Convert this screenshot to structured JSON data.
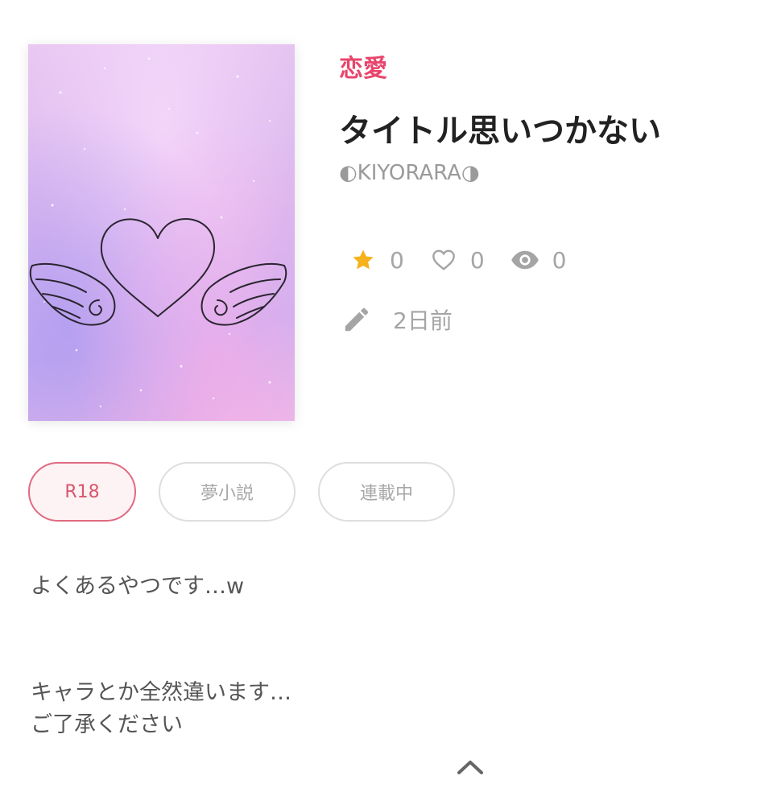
{
  "work": {
    "category": "恋愛",
    "title": "タイトル思いつかない",
    "author": "◐KIYORARA◑",
    "cover_icon": "heart-with-wings",
    "stats": {
      "stars": "0",
      "likes": "0",
      "views": "0"
    },
    "updated": "2日前",
    "tags": [
      "R18",
      "夢小説",
      "連載中"
    ],
    "description": [
      "よくあるやつです…w",
      "キャラとか全然違います…",
      "ご了承ください"
    ],
    "collapse_icon": "chevron-up-icon"
  },
  "colors": {
    "category": "#e8456c",
    "star": "#f5b21c",
    "r18_border": "#e06a80"
  }
}
